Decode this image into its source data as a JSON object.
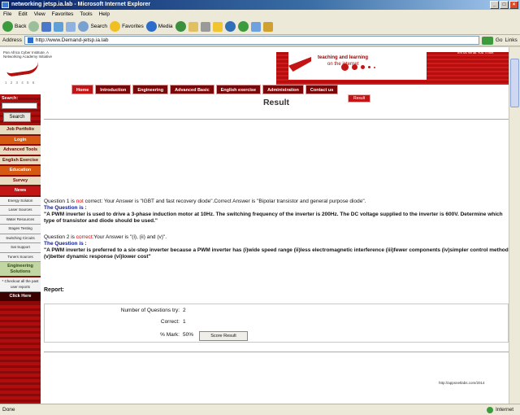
{
  "window": {
    "title": "networking jetsp.ia.lab - Microsoft Internet Explorer",
    "minimize": "_",
    "maximize": "□",
    "close": "×"
  },
  "menu": [
    "File",
    "Edit",
    "View",
    "Favorites",
    "Tools",
    "Help"
  ],
  "toolbar": {
    "back": "Back",
    "search": "Search",
    "favorites": "Favorites",
    "media": "Media"
  },
  "address": {
    "label": "Address",
    "url": "http://www.Demand-jetsp.ia.lab",
    "go": "Go",
    "links": "Links"
  },
  "header": {
    "logo_small": "Pan Africa Cyber Institute, A Networking Academy Initiative",
    "logo_tag": "1 2 3 4 5 6",
    "brand_line1": "teaching and learning",
    "brand_line2": "on the internet",
    "top_link": "Tell us What You Think",
    "nav": [
      "Home",
      "Introduction",
      "Engineering",
      "Advanced Basic",
      "English exercise",
      "Administration",
      "Contact us"
    ],
    "sub_tab": "Result"
  },
  "sidebar": {
    "search_label": "Search:",
    "search_button": "Search",
    "menu": [
      {
        "label": "Job Portfolio",
        "style": "m"
      },
      {
        "label": "Login",
        "style": "m hl"
      },
      {
        "label": "Advanced Tools",
        "style": "m"
      },
      {
        "label": "English Exercise",
        "style": "m"
      },
      {
        "label": "Education",
        "style": "m hl"
      },
      {
        "label": "Survey",
        "style": "m"
      },
      {
        "label": "News",
        "style": "m red"
      },
      {
        "label": "Energy Soluton",
        "style": "m white"
      },
      {
        "label": "Laser Sources",
        "style": "m white"
      },
      {
        "label": "Water Resources",
        "style": "m white"
      },
      {
        "label": "Stages Testing",
        "style": "m white"
      },
      {
        "label": "Switching Circuits",
        "style": "m white"
      },
      {
        "label": "Sat Support",
        "style": "m white"
      },
      {
        "label": "Tuners Sources",
        "style": "m white"
      },
      {
        "label": "Engineering Solutions",
        "style": "m green"
      },
      {
        "label": "* Checkout all the past user reports",
        "style": "m white"
      },
      {
        "label": "Click Here",
        "style": "m dark"
      }
    ]
  },
  "content": {
    "title": "Result",
    "q1": {
      "prefix": "Question 1 is ",
      "status": "not",
      "suffix": " correct: Your Answer is \"IGBT and fast recovery diode\".Correct Answer is \"Bipolar transistor and general purpose diode\".",
      "label": "The Question is :",
      "text": "\"A PWM inverter is used to drive a 3-phase induction motor at 10Hz. The switching frequency of the inverter is 200Hz. The DC voltage supplied to the inverter is 600V. Determine which type of transistor and diode should be used.\""
    },
    "q2": {
      "prefix": "Question 2 is ",
      "status": "correct",
      "suffix": ":Your Answer is \"(i), (ii) and (v)\".",
      "label": "The Question is :",
      "text": "\"A PWM inverter is preferred to a six-step inverter because a PWM inverter has (i)wide speed range (ii)less electromagnetic interference (iii)fewer components (iv)simpler control method (v)better dynamic response (vi)lower cost\""
    },
    "report_label": "Report:",
    "report": {
      "questions_label": "Number of Questions try:",
      "questions_value": "2",
      "correct_label": "Correct:",
      "correct_value": "1",
      "mark_label": "% Mark:",
      "mark_value": "50%",
      "score_button": "Score Result"
    },
    "footer_note": "http://appsnetlabs.com/2014"
  },
  "status": {
    "left": "Done",
    "zone": "Internet"
  },
  "colors": {
    "brand_red": "#c31515",
    "dark_red": "#7a0808",
    "accent_orange": "#d65a12"
  }
}
